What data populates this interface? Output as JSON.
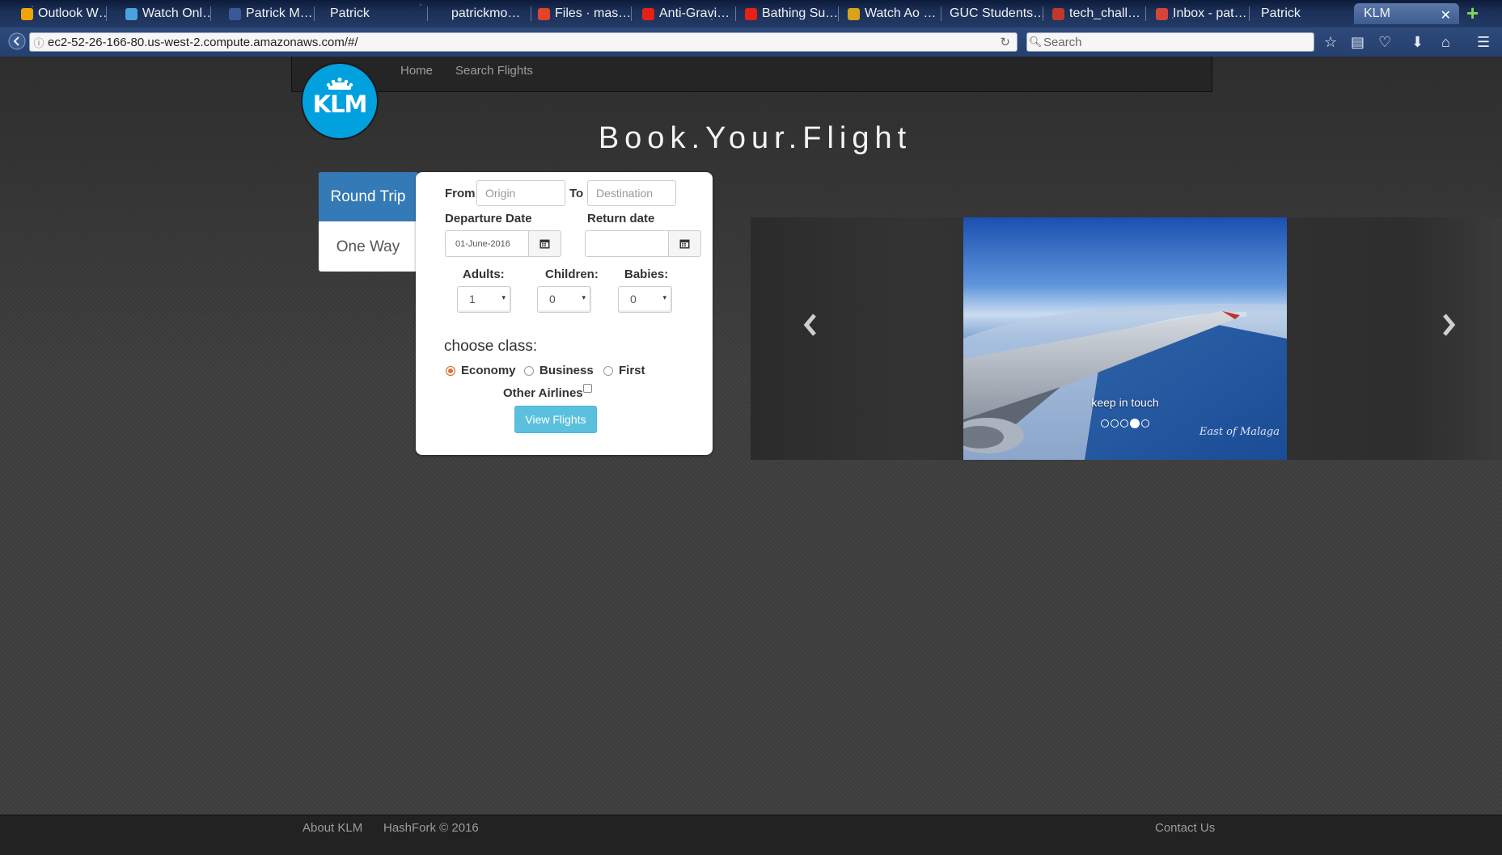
{
  "browser": {
    "tabs": [
      {
        "label": "Outlook W…",
        "color": "#f0a30a"
      },
      {
        "label": "Watch Onl…",
        "color": "#4aa3df"
      },
      {
        "label": "Patrick M…",
        "color": "#3b5998"
      },
      {
        "label": "Patrick",
        "color": "#223344"
      },
      {
        "label": "patrickmo…",
        "color": "#1a2a44"
      },
      {
        "label": "Files · mas…",
        "color": "#e24329"
      },
      {
        "label": "Anti-Gravi…",
        "color": "#e62117"
      },
      {
        "label": "Bathing Su…",
        "color": "#e62117"
      },
      {
        "label": "Watch Ao …",
        "color": "#d9a21b"
      },
      {
        "label": "GUC Students…",
        "color": "#1a2a44"
      },
      {
        "label": "tech_chall…",
        "color": "#c0392b"
      },
      {
        "label": "Inbox - pat…",
        "color": "#d44638"
      },
      {
        "label": "Patrick",
        "color": "#1a2a44"
      },
      {
        "label": "KLM",
        "color": "#00a1de"
      }
    ],
    "url": "ec2-52-26-166-80.us-west-2.compute.amazonaws.com/#/",
    "search_placeholder": "Search"
  },
  "site": {
    "nav": {
      "home": "Home",
      "search_flights": "Search Flights"
    },
    "logo_text": "KLM",
    "brand_color": "#00a1de",
    "title": "Book.Your.Flight"
  },
  "trip_type": {
    "round_trip": "Round Trip",
    "one_way": "One Way",
    "selected": "Round Trip"
  },
  "form": {
    "from_label": "From",
    "from_placeholder": "Origin",
    "to_label": "To",
    "to_placeholder": "Destination",
    "departure_label": "Departure Date",
    "departure_value": "01-June-2016",
    "return_label": "Return date",
    "return_value": "",
    "adults_label": "Adults:",
    "adults_value": "1",
    "children_label": "Children:",
    "children_value": "0",
    "babies_label": "Babies:",
    "babies_value": "0",
    "class_label": "choose class:",
    "classes": [
      "Economy",
      "Business",
      "First"
    ],
    "selected_class": "Economy",
    "other_airlines_label": "Other Airlines",
    "other_airlines_checked": false,
    "submit_label": "View Flights"
  },
  "carousel": {
    "caption": "keep in touch",
    "watermark": "East of Malaga",
    "slide_count": 5,
    "active_slide": 4
  },
  "footer": {
    "about": "About KLM",
    "copyright": "HashFork © 2016",
    "contact": "Contact Us"
  }
}
